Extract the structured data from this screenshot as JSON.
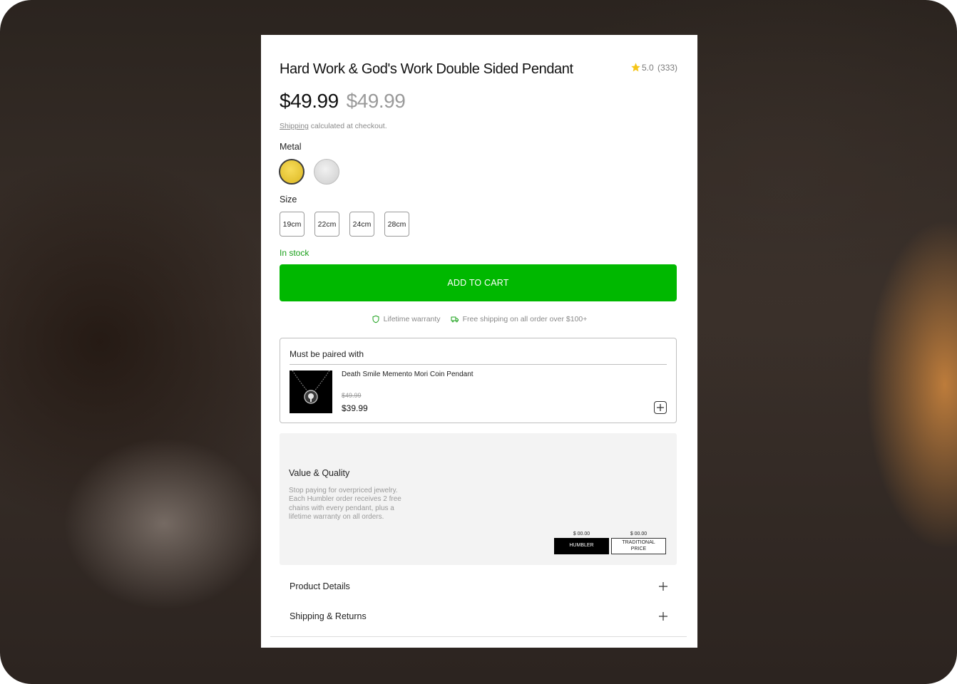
{
  "product": {
    "title": "Hard Work & God's Work Double Sided Pendant",
    "rating_value": "5.0",
    "rating_count": "(333)",
    "price": "$49.99",
    "compare_price": "$49.99",
    "shipping_link": "Shipping",
    "shipping_note": "calculated at checkout."
  },
  "options": {
    "metal_label": "Metal",
    "metals": [
      {
        "name": "gold",
        "color": "#e9c93a",
        "selected": true
      },
      {
        "name": "silver",
        "color": "#d9d9d9",
        "selected": false
      }
    ],
    "size_label": "Size",
    "sizes": [
      "19cm",
      "22cm",
      "24cm",
      "28cm"
    ]
  },
  "stock_status": "In stock",
  "cart_button": "ADD TO CART",
  "perks": {
    "warranty": "Lifetime warranty",
    "shipping": "Free shipping on all order over $100+"
  },
  "pairing": {
    "heading": "Must be paired with",
    "item_name": "Death Smile Memento Mori Coin Pendant",
    "item_old_price": "$49.99",
    "item_price": "$39.99"
  },
  "value": {
    "title": "Value & Quality",
    "text": "Stop paying for overpriced jewelry. Each Humbler order receives 2 free chains with every pendant, plus a lifetime warranty on all orders.",
    "humbler_price": "$ 00.00",
    "humbler_label": "HUMBLER",
    "traditional_price": "$ 00.00",
    "traditional_label": "TRADITIONAL PRICE"
  },
  "accordion": {
    "details": "Product Details",
    "shipping": "Shipping & Returns"
  },
  "colors": {
    "accent_green": "#00b800",
    "stock_green": "#1aa01a",
    "star": "#f5c518"
  }
}
